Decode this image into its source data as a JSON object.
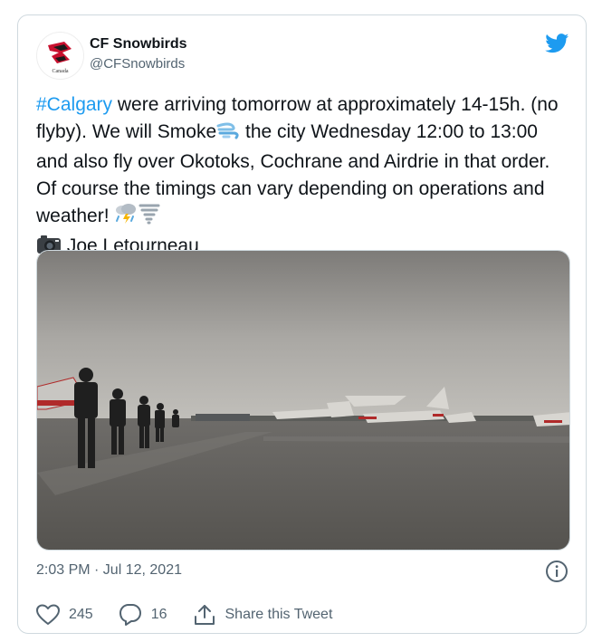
{
  "user": {
    "display_name": "CF Snowbirds",
    "handle": "@CFSnowbirds",
    "avatar_caption": "Canada"
  },
  "tweet": {
    "hashtag": "#Calgary",
    "part1": " were arriving tomorrow at approximately 14-15h. (no flyby). We will Smoke",
    "part2": " the city Wednesday 12:00 to 13:00 and also fly over Okotoks, Cochrane and Airdrie in that order. Of course the timings can vary depending on operations and weather! ",
    "credit": " Joe Letourneau",
    "icons": [
      "wind-face-emoji",
      "thunder-cloud-rain-emoji",
      "tornado-emoji",
      "camera-emoji"
    ]
  },
  "timestamp": "2:03 PM · Jul 12, 2021",
  "actions": {
    "likes": "245",
    "replies": "16",
    "share_label": "Share this Tweet"
  },
  "colors": {
    "accent": "#1d9bf0",
    "secondary_text": "#536471",
    "border": "#cfd9de"
  }
}
